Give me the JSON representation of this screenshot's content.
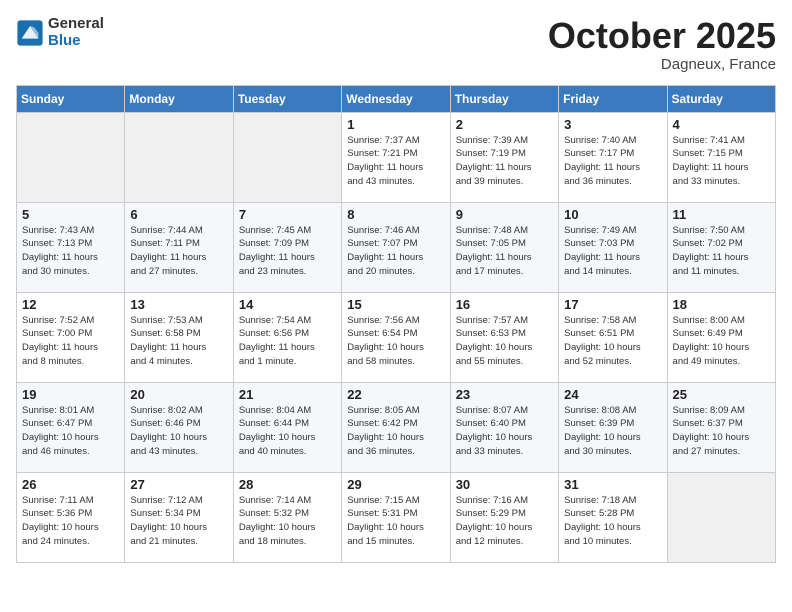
{
  "header": {
    "logo_general": "General",
    "logo_blue": "Blue",
    "month": "October 2025",
    "location": "Dagneux, France"
  },
  "weekdays": [
    "Sunday",
    "Monday",
    "Tuesday",
    "Wednesday",
    "Thursday",
    "Friday",
    "Saturday"
  ],
  "weeks": [
    [
      {
        "day": "",
        "info": ""
      },
      {
        "day": "",
        "info": ""
      },
      {
        "day": "",
        "info": ""
      },
      {
        "day": "1",
        "info": "Sunrise: 7:37 AM\nSunset: 7:21 PM\nDaylight: 11 hours\nand 43 minutes."
      },
      {
        "day": "2",
        "info": "Sunrise: 7:39 AM\nSunset: 7:19 PM\nDaylight: 11 hours\nand 39 minutes."
      },
      {
        "day": "3",
        "info": "Sunrise: 7:40 AM\nSunset: 7:17 PM\nDaylight: 11 hours\nand 36 minutes."
      },
      {
        "day": "4",
        "info": "Sunrise: 7:41 AM\nSunset: 7:15 PM\nDaylight: 11 hours\nand 33 minutes."
      }
    ],
    [
      {
        "day": "5",
        "info": "Sunrise: 7:43 AM\nSunset: 7:13 PM\nDaylight: 11 hours\nand 30 minutes."
      },
      {
        "day": "6",
        "info": "Sunrise: 7:44 AM\nSunset: 7:11 PM\nDaylight: 11 hours\nand 27 minutes."
      },
      {
        "day": "7",
        "info": "Sunrise: 7:45 AM\nSunset: 7:09 PM\nDaylight: 11 hours\nand 23 minutes."
      },
      {
        "day": "8",
        "info": "Sunrise: 7:46 AM\nSunset: 7:07 PM\nDaylight: 11 hours\nand 20 minutes."
      },
      {
        "day": "9",
        "info": "Sunrise: 7:48 AM\nSunset: 7:05 PM\nDaylight: 11 hours\nand 17 minutes."
      },
      {
        "day": "10",
        "info": "Sunrise: 7:49 AM\nSunset: 7:03 PM\nDaylight: 11 hours\nand 14 minutes."
      },
      {
        "day": "11",
        "info": "Sunrise: 7:50 AM\nSunset: 7:02 PM\nDaylight: 11 hours\nand 11 minutes."
      }
    ],
    [
      {
        "day": "12",
        "info": "Sunrise: 7:52 AM\nSunset: 7:00 PM\nDaylight: 11 hours\nand 8 minutes."
      },
      {
        "day": "13",
        "info": "Sunrise: 7:53 AM\nSunset: 6:58 PM\nDaylight: 11 hours\nand 4 minutes."
      },
      {
        "day": "14",
        "info": "Sunrise: 7:54 AM\nSunset: 6:56 PM\nDaylight: 11 hours\nand 1 minute."
      },
      {
        "day": "15",
        "info": "Sunrise: 7:56 AM\nSunset: 6:54 PM\nDaylight: 10 hours\nand 58 minutes."
      },
      {
        "day": "16",
        "info": "Sunrise: 7:57 AM\nSunset: 6:53 PM\nDaylight: 10 hours\nand 55 minutes."
      },
      {
        "day": "17",
        "info": "Sunrise: 7:58 AM\nSunset: 6:51 PM\nDaylight: 10 hours\nand 52 minutes."
      },
      {
        "day": "18",
        "info": "Sunrise: 8:00 AM\nSunset: 6:49 PM\nDaylight: 10 hours\nand 49 minutes."
      }
    ],
    [
      {
        "day": "19",
        "info": "Sunrise: 8:01 AM\nSunset: 6:47 PM\nDaylight: 10 hours\nand 46 minutes."
      },
      {
        "day": "20",
        "info": "Sunrise: 8:02 AM\nSunset: 6:46 PM\nDaylight: 10 hours\nand 43 minutes."
      },
      {
        "day": "21",
        "info": "Sunrise: 8:04 AM\nSunset: 6:44 PM\nDaylight: 10 hours\nand 40 minutes."
      },
      {
        "day": "22",
        "info": "Sunrise: 8:05 AM\nSunset: 6:42 PM\nDaylight: 10 hours\nand 36 minutes."
      },
      {
        "day": "23",
        "info": "Sunrise: 8:07 AM\nSunset: 6:40 PM\nDaylight: 10 hours\nand 33 minutes."
      },
      {
        "day": "24",
        "info": "Sunrise: 8:08 AM\nSunset: 6:39 PM\nDaylight: 10 hours\nand 30 minutes."
      },
      {
        "day": "25",
        "info": "Sunrise: 8:09 AM\nSunset: 6:37 PM\nDaylight: 10 hours\nand 27 minutes."
      }
    ],
    [
      {
        "day": "26",
        "info": "Sunrise: 7:11 AM\nSunset: 5:36 PM\nDaylight: 10 hours\nand 24 minutes."
      },
      {
        "day": "27",
        "info": "Sunrise: 7:12 AM\nSunset: 5:34 PM\nDaylight: 10 hours\nand 21 minutes."
      },
      {
        "day": "28",
        "info": "Sunrise: 7:14 AM\nSunset: 5:32 PM\nDaylight: 10 hours\nand 18 minutes."
      },
      {
        "day": "29",
        "info": "Sunrise: 7:15 AM\nSunset: 5:31 PM\nDaylight: 10 hours\nand 15 minutes."
      },
      {
        "day": "30",
        "info": "Sunrise: 7:16 AM\nSunset: 5:29 PM\nDaylight: 10 hours\nand 12 minutes."
      },
      {
        "day": "31",
        "info": "Sunrise: 7:18 AM\nSunset: 5:28 PM\nDaylight: 10 hours\nand 10 minutes."
      },
      {
        "day": "",
        "info": ""
      }
    ]
  ]
}
